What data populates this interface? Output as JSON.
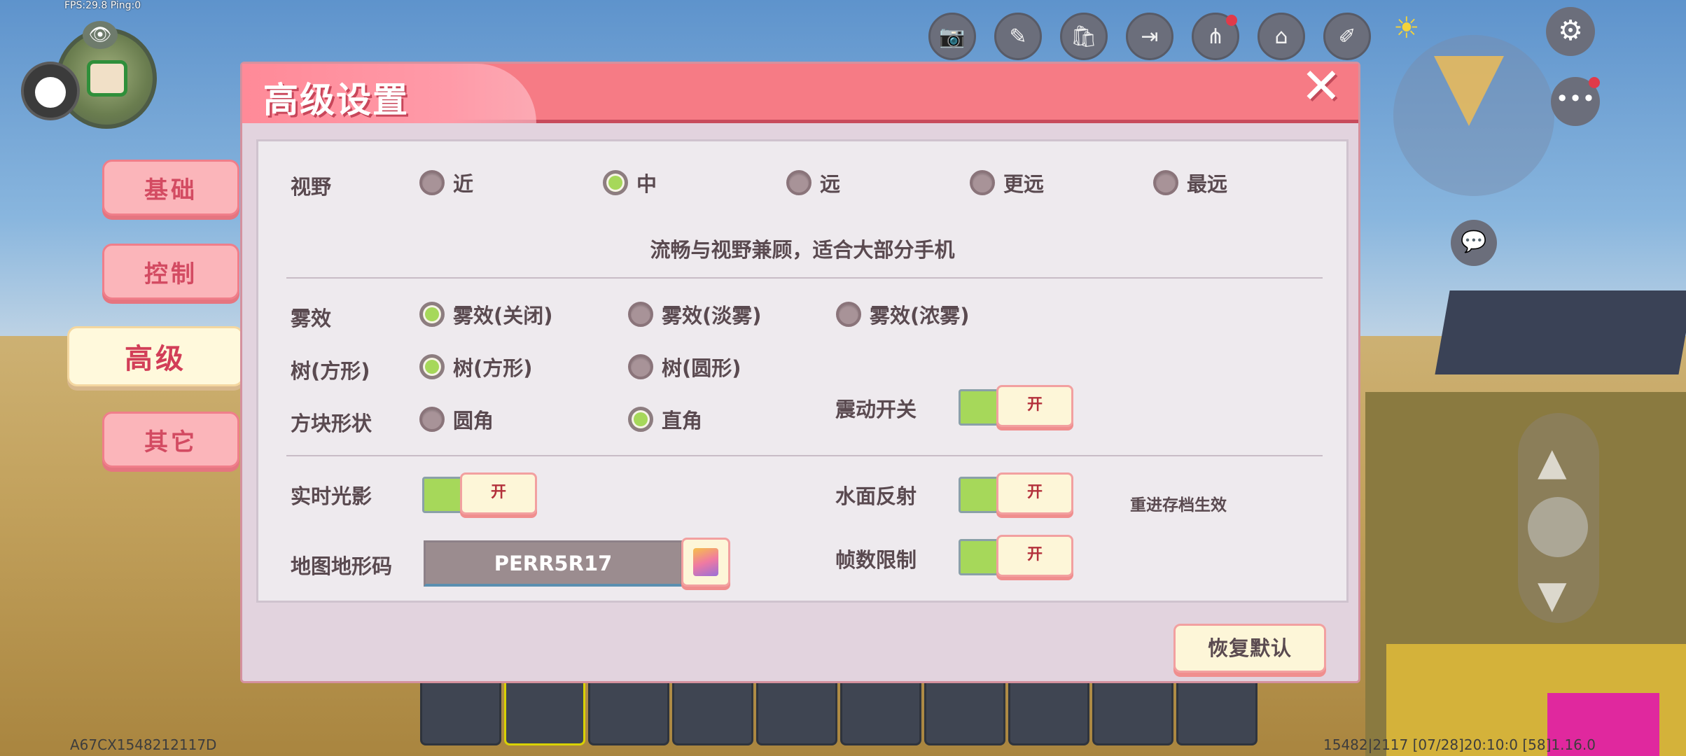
{
  "hud": {
    "fps_text": "FPS:29.8  Ping:0",
    "bottom_left_code": "A67CX1548212117D",
    "bottom_right_info": "15482|2117   [07/28]20:10:0   [58]1.16.0"
  },
  "toolbar": {
    "icons": [
      "camera-icon",
      "edit-tools-icon",
      "shop-icon",
      "exit-icon",
      "share-icon",
      "home-icon",
      "note-icon"
    ]
  },
  "tabs": [
    {
      "label": "基础",
      "active": false
    },
    {
      "label": "控制",
      "active": false
    },
    {
      "label": "高级",
      "active": true
    },
    {
      "label": "其它",
      "active": false
    }
  ],
  "dialog": {
    "title": "高级设置",
    "view": {
      "label": "视野",
      "options": [
        {
          "label": "近",
          "selected": false
        },
        {
          "label": "中",
          "selected": true
        },
        {
          "label": "远",
          "selected": false
        },
        {
          "label": "更远",
          "selected": false
        },
        {
          "label": "最远",
          "selected": false
        }
      ],
      "hint": "流畅与视野兼顾，适合大部分手机"
    },
    "fog": {
      "label": "雾效",
      "options": [
        {
          "label": "雾效(关闭)",
          "selected": true
        },
        {
          "label": "雾效(淡雾)",
          "selected": false
        },
        {
          "label": "雾效(浓雾)",
          "selected": false
        }
      ]
    },
    "tree": {
      "label": "树(方形)",
      "options": [
        {
          "label": "树(方形)",
          "selected": true
        },
        {
          "label": "树(圆形)",
          "selected": false
        }
      ]
    },
    "block_shape": {
      "label": "方块形状",
      "options": [
        {
          "label": "圆角",
          "selected": false
        },
        {
          "label": "直角",
          "selected": true
        }
      ]
    },
    "vibration": {
      "label": "震动开关",
      "state": "开"
    },
    "realtime_shadow": {
      "label": "实时光影",
      "state": "开"
    },
    "water_reflection": {
      "label": "水面反射",
      "state": "开",
      "note": "重进存档生效"
    },
    "map_code": {
      "label": "地图地形码",
      "value": "PERR5R17"
    },
    "frame_limit": {
      "label": "帧数限制",
      "state": "开"
    },
    "reset_label": "恢复默认"
  },
  "colors": {
    "header": "#f67b85",
    "panel": "#eeeaee",
    "selected_dot": "#a6d85a",
    "switch_text": "#b3303b"
  }
}
